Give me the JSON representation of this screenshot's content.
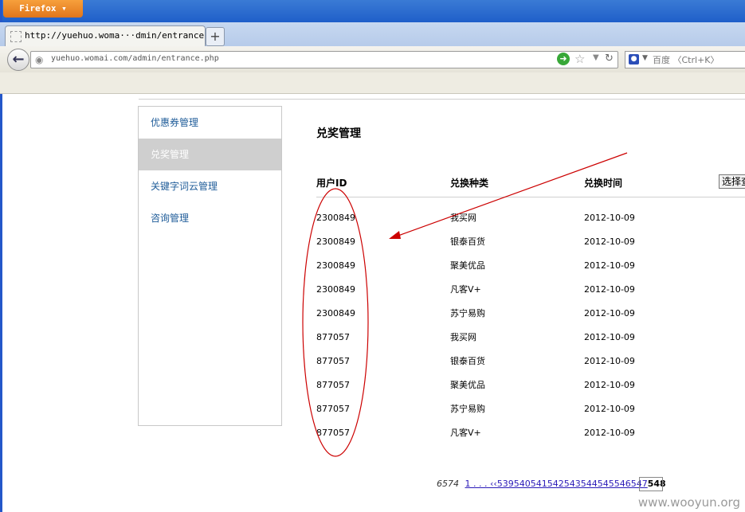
{
  "browser": {
    "menu_button": "Firefox ▾",
    "tab_title": "http://yuehuo.woma···dmin/entrance.php",
    "new_tab": "+",
    "url": "yuehuo.womai.com/admin/entrance.php",
    "search_placeholder": "百度 〈Ctrl+K〉",
    "search_engine_icon": "baidu-paw-icon"
  },
  "sidebar": {
    "items": [
      {
        "label": "优惠券管理",
        "active": false
      },
      {
        "label": "兑奖管理",
        "active": true
      },
      {
        "label": "关键字词云管理",
        "active": false
      },
      {
        "label": "咨询管理",
        "active": false
      }
    ]
  },
  "main": {
    "title": "兑奖管理",
    "columns": [
      "用户ID",
      "兑换种类",
      "兑换时间"
    ],
    "select_button": "选择查看",
    "rows": [
      [
        "2300849",
        "我买网",
        "2012-10-09"
      ],
      [
        "2300849",
        "银泰百货",
        "2012-10-09"
      ],
      [
        "2300849",
        "聚美优品",
        "2012-10-09"
      ],
      [
        "2300849",
        "凡客V+",
        "2012-10-09"
      ],
      [
        "2300849",
        "苏宁易购",
        "2012-10-09"
      ],
      [
        "877057",
        "我买网",
        "2012-10-09"
      ],
      [
        "877057",
        "银泰百货",
        "2012-10-09"
      ],
      [
        "877057",
        "聚美优品",
        "2012-10-09"
      ],
      [
        "877057",
        "苏宁易购",
        "2012-10-09"
      ],
      [
        "877057",
        "凡客V+",
        "2012-10-09"
      ]
    ]
  },
  "pager": {
    "total": "6574",
    "links": "1 . . . ‹‹539540541542543544545546547",
    "current": "548"
  },
  "watermark": "www.wooyun.org",
  "colors": {
    "annotation": "#cc0000",
    "link": "#1f5c99",
    "active_bg": "#cfcfcf"
  }
}
